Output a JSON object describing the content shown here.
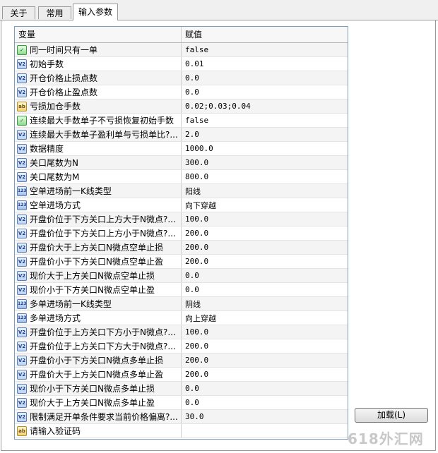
{
  "tabs": [
    {
      "label": "关于"
    },
    {
      "label": "常用"
    },
    {
      "label": "输入参数"
    }
  ],
  "grid": {
    "header": {
      "variable": "变量",
      "value": "赋值"
    },
    "rows": [
      {
        "icon": "bool-icon",
        "name": "同一时间只有一单",
        "value": "false"
      },
      {
        "icon": "double-icon",
        "name": "初始手数",
        "value": "0.01"
      },
      {
        "icon": "double-icon",
        "name": "开仓价格止损点数",
        "value": "0.0"
      },
      {
        "icon": "double-icon",
        "name": "开仓价格止盈点数",
        "value": "0.0"
      },
      {
        "icon": "string-icon",
        "name": "亏损加仓手数",
        "value": "0.02;0.03;0.04"
      },
      {
        "icon": "bool-icon",
        "name": "连续最大手数单子不亏损恢复初始手数",
        "value": "false"
      },
      {
        "icon": "double-icon",
        "name": "连续最大手数单子盈利单与亏损单比?...",
        "value": "2.0"
      },
      {
        "icon": "double-icon",
        "name": "数据精度",
        "value": "1000.0"
      },
      {
        "icon": "double-icon",
        "name": "关口尾数为N",
        "value": "300.0"
      },
      {
        "icon": "double-icon",
        "name": "关口尾数为M",
        "value": "800.0"
      },
      {
        "icon": "int-icon",
        "name": "空单进场前一K线类型",
        "value": "阳线"
      },
      {
        "icon": "int-icon",
        "name": "空单进场方式",
        "value": "向下穿越"
      },
      {
        "icon": "double-icon",
        "name": "开盘价位于下方关口上方大于N微点?...",
        "value": "100.0"
      },
      {
        "icon": "double-icon",
        "name": "开盘价位于下方关口上方小于N微点?...",
        "value": "200.0"
      },
      {
        "icon": "double-icon",
        "name": "开盘价大于上方关口N微点空单止损",
        "value": "200.0"
      },
      {
        "icon": "double-icon",
        "name": "开盘价小于下方关口N微点空单止盈",
        "value": "200.0"
      },
      {
        "icon": "double-icon",
        "name": "现价大于上方关口N微点空单止损",
        "value": "0.0"
      },
      {
        "icon": "double-icon",
        "name": "现价小于下方关口N微点空单止盈",
        "value": "0.0"
      },
      {
        "icon": "int-icon",
        "name": "多单进场前一K线类型",
        "value": "阴线"
      },
      {
        "icon": "int-icon",
        "name": "多单进场方式",
        "value": "向上穿越"
      },
      {
        "icon": "double-icon",
        "name": "开盘价位于上方关口下方小于N微点?...",
        "value": "100.0"
      },
      {
        "icon": "double-icon",
        "name": "开盘价位于上方关口下方大于N微点?...",
        "value": "200.0"
      },
      {
        "icon": "double-icon",
        "name": "开盘价小于下方关口N微点多单止损",
        "value": "200.0"
      },
      {
        "icon": "double-icon",
        "name": "开盘价大于上方关口N微点多单止盈",
        "value": "200.0"
      },
      {
        "icon": "double-icon",
        "name": "现价小于下方关口N微点多单止损",
        "value": "0.0"
      },
      {
        "icon": "double-icon",
        "name": "现价大于上方关口N微点多单止盈",
        "value": "0.0"
      },
      {
        "icon": "double-icon",
        "name": "限制满足开单条件要求当前价格偏离?...",
        "value": "30.0"
      },
      {
        "icon": "string-icon",
        "name": "请输入验证码",
        "value": ""
      }
    ]
  },
  "load_button": {
    "label": "加载(L)"
  },
  "watermark": {
    "text": "618外汇网"
  },
  "icon_glyphs": {
    "double-icon": "V2",
    "int-icon": "123",
    "bool-icon": "✓",
    "string-icon": "ab"
  }
}
